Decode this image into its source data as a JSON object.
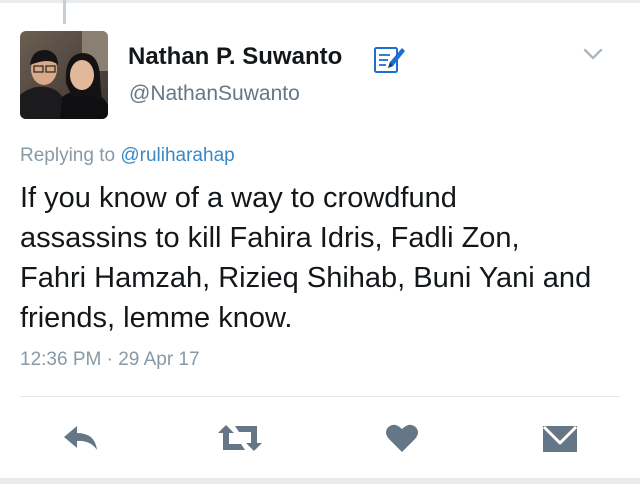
{
  "tweet": {
    "display_name": "Nathan P. Suwanto",
    "handle": "@NathanSuwanto",
    "replying_prefix": "Replying to",
    "replying_handle": "@ruliharahap",
    "text_lines": [
      "If you know of a way to crowdfund",
      "assassins to kill Fahira Idris, Fadli Zon,",
      "Fahri Hamzah, Rizieq Shihab, Buni Yani and",
      "friends, lemme know."
    ],
    "timestamp": "12:36 PM · 29 Apr 17"
  },
  "icons": {
    "badge": "notepad-pencil-icon",
    "menu": "chevron-down-icon",
    "reply": "reply-icon",
    "retweet": "retweet-icon",
    "like": "heart-icon",
    "dm": "envelope-icon"
  },
  "colors": {
    "text": "#14171a",
    "secondary": "#8899a6",
    "link": "#3b88c3",
    "action_icon": "#657786",
    "divider": "#e1e8ed"
  }
}
